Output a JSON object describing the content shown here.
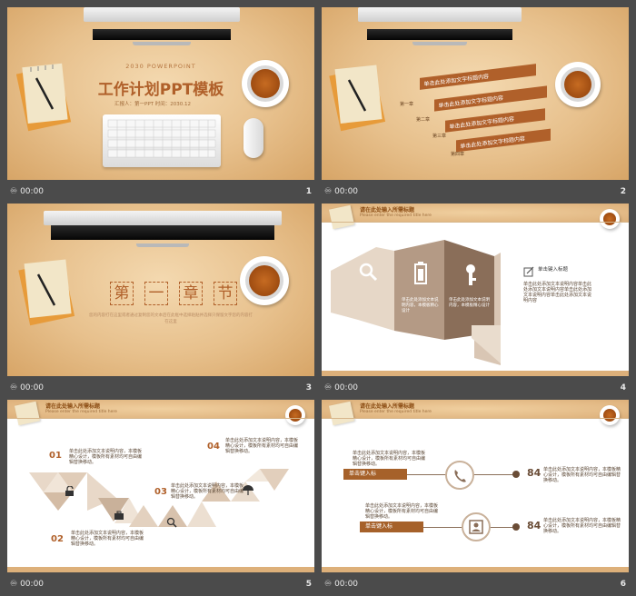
{
  "status_bar": {
    "icon": "loop-icon",
    "time": "00:00"
  },
  "slides": [
    {
      "number": "1",
      "subtitle": "2030 POWERPOINT",
      "title": "工作计划PPT模板",
      "reporter": "汇报人：第一PPT  时间：2030.12"
    },
    {
      "number": "2",
      "items": [
        {
          "label": "第一章",
          "text": "单击此处添加文字标题内容"
        },
        {
          "label": "第二章",
          "text": "单击此处添加文字标题内容"
        },
        {
          "label": "第三章",
          "text": "单击此处添加文字标题内容"
        },
        {
          "label": "第四章",
          "text": "单击此处添加文字标题内容"
        }
      ]
    },
    {
      "number": "3",
      "chars": [
        "第",
        "一",
        "章",
        "节"
      ],
      "desc": "您的内容打在这里或者通过复制您的文本后在此框中选择粘贴并选择只保留文字您的内容打在这里"
    },
    {
      "number": "4",
      "header_title": "请在此处输入所需标题",
      "header_sub": "Please enter the required title here",
      "title": "单击键入标题",
      "side_text": "单击此处添加文本说明内容单击此处添加文本说明内容单击此处添加文本说明内容单击此处添加文本说明内容",
      "panel_text_1": "单击此处添加文本说明内容，本模板精心设计",
      "panel_text_2": "单击此处添加文本说明内容，本模板精心设计"
    },
    {
      "number": "5",
      "header_title": "请在此处输入所需标题",
      "header_sub": "Please enter the required title here",
      "steps": [
        {
          "num": "01",
          "text": "单击此处添加文本说明内容，本模板精心设计，模板所有素材均可自由编辑替换移动。"
        },
        {
          "num": "02",
          "text": "单击此处添加文本说明内容，本模板精心设计，模板所有素材均可自由编辑替换移动。"
        },
        {
          "num": "03",
          "text": "单击此处添加文本说明内容，本模板精心设计，模板所有素材均可自由编辑替换移动。"
        },
        {
          "num": "04",
          "text": "单击此处添加文本说明内容，本模板精心设计，模板所有素材均可自由编辑替换移动。"
        }
      ]
    },
    {
      "number": "6",
      "header_title": "请在此处输入所需标题",
      "header_sub": "Please enter the required title here",
      "rows": [
        {
          "label": "单击键入标",
          "value": "84",
          "left_text": "单击此处添加文本说明内容，本模板精心设计，模板所有素材均可自由编辑替换移动。",
          "right_text": "单击此处添加文本说明内容，本模板精心设计，模板所有素材均可自由编辑替换移动。"
        },
        {
          "label": "单击键入标",
          "value": "84",
          "left_text": "单击此处添加文本说明内容，本模板精心设计，模板所有素材均可自由编辑替换移动。",
          "right_text": "单击此处添加文本说明内容，本模板精心设计，模板所有素材均可自由编辑替换移动。"
        }
      ]
    }
  ],
  "colors": {
    "accent": "#a6612a",
    "paper": "#e7c08c",
    "taupe": "#b49a85",
    "light": "#e8d8c8"
  }
}
